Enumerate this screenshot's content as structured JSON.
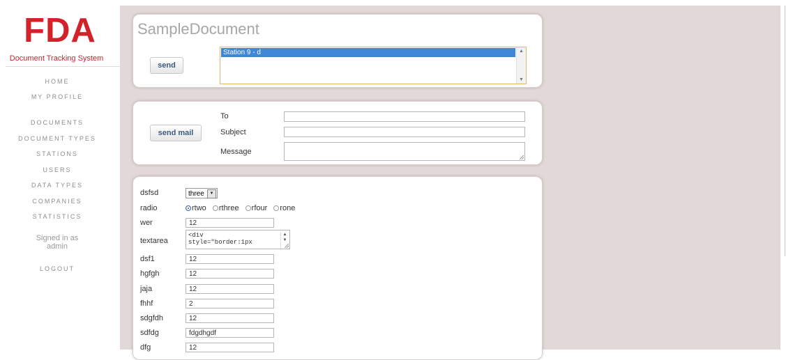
{
  "sidebar": {
    "logo": "FDA",
    "subtitle": "Document Tracking System",
    "nav": [
      "HOME",
      "MY PROFILE",
      "DOCUMENTS",
      "DOCUMENT TYPES",
      "STATIONS",
      "USERS",
      "DATA TYPES",
      "COMPANIES",
      "STATISTICS"
    ],
    "signed_in_line1": "Signed in as",
    "signed_in_user": "admin",
    "logout": "LOGOUT"
  },
  "document": {
    "title": "SampleDocument",
    "send_label": "send",
    "stations": [
      "Station 9 - d"
    ]
  },
  "mail": {
    "send_label": "send mail",
    "to_label": "To",
    "subject_label": "Subject",
    "message_label": "Message",
    "to_value": "",
    "subject_value": "",
    "message_value": ""
  },
  "fields": {
    "dsfsd_label": "dsfsd",
    "dsfsd_value": "three",
    "radio_label": "radio",
    "radio_options": [
      "rtwo",
      "rthree",
      "rfour",
      "rone"
    ],
    "radio_selected": "rtwo",
    "wer_label": "wer",
    "wer_value": "12",
    "textarea_label": "textarea",
    "textarea_value": "<div\nstyle=\"border:1px",
    "dsf1_label": "dsf1",
    "dsf1_value": "12",
    "hgfgh_label": "hgfgh",
    "hgfgh_value": "12",
    "jaja_label": "jaja",
    "jaja_value": "12",
    "fhhf_label": "fhhf",
    "fhhf_value": "2",
    "sdgfdh_label": "sdgfdh",
    "sdgfdh_value": "12",
    "sdfdg_label": "sdfdg",
    "sdfdg_value": "fdgdhgdf",
    "dfg_label": "dfg",
    "dfg_value": "12"
  },
  "colors": {
    "brand_red": "#d2232a",
    "main_bg": "#e3d8d8",
    "selection_blue": "#3f86d6"
  }
}
